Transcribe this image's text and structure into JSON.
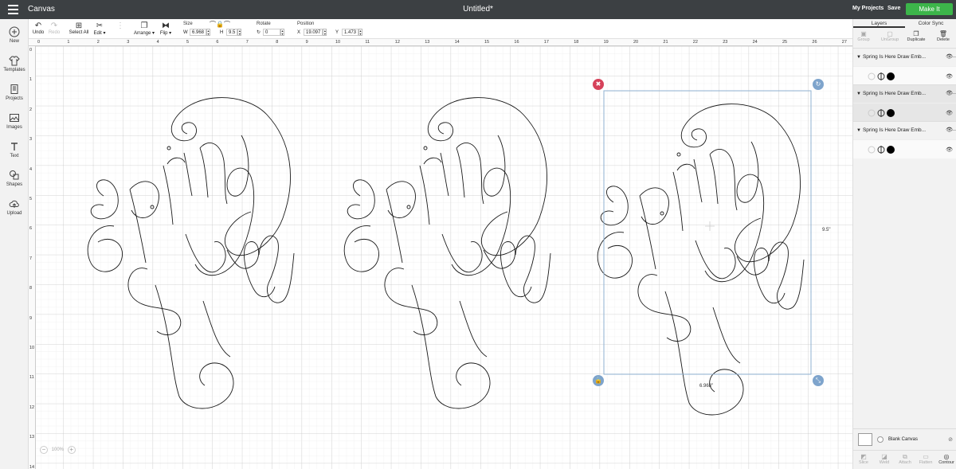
{
  "topbar": {
    "app_title": "Canvas",
    "doc_title": "Untitled*",
    "my_projects": "My Projects",
    "save": "Save",
    "make_it": "Make It",
    "make_it_color": "#3cb54a"
  },
  "toolbar": {
    "undo": "Undo",
    "redo": "Redo",
    "select_all": "Select All",
    "edit": "Edit ▾",
    "arrange": "Arrange ▾",
    "flip": "Flip ▾",
    "size_label": "Size",
    "w_label": "W",
    "w_value": "6.968",
    "h_label": "H",
    "h_value": "9.5",
    "rotate_label": "Rotate",
    "rotate_value": "0",
    "position_label": "Position",
    "x_label": "X",
    "x_value": "19.097",
    "y_label": "Y",
    "y_value": "1.473"
  },
  "leftpanel": {
    "items": [
      "New",
      "Templates",
      "Projects",
      "Images",
      "Text",
      "Shapes",
      "Upload"
    ]
  },
  "canvas": {
    "ruler_top": [
      "0",
      "1",
      "2",
      "3",
      "4",
      "5",
      "6",
      "7",
      "8",
      "9",
      "10",
      "11",
      "12",
      "13",
      "14",
      "15",
      "16",
      "17",
      "18",
      "19",
      "20",
      "21",
      "22",
      "23",
      "24",
      "25",
      "26",
      "27"
    ],
    "ruler_left": [
      "0",
      "1",
      "2",
      "3",
      "4",
      "5",
      "6",
      "7",
      "8",
      "9",
      "10",
      "11",
      "12",
      "13",
      "14"
    ],
    "zoom_value": "100%",
    "width_dim": "6.968\"",
    "height_dim": "9.5\""
  },
  "rightpanel": {
    "tabs": [
      "Layers",
      "Color Sync"
    ],
    "tools": [
      "Group",
      "UnGroup",
      "Duplicate",
      "Delete"
    ],
    "layers": [
      "Spring Is Here Draw Emb...",
      "Spring Is Here Draw Emb...",
      "Spring Is Here Draw Emb..."
    ],
    "blank_canvas": "Blank Canvas",
    "bottom_tools": [
      "Slice",
      "Weld",
      "Attach",
      "Flatten",
      "Contour"
    ]
  }
}
